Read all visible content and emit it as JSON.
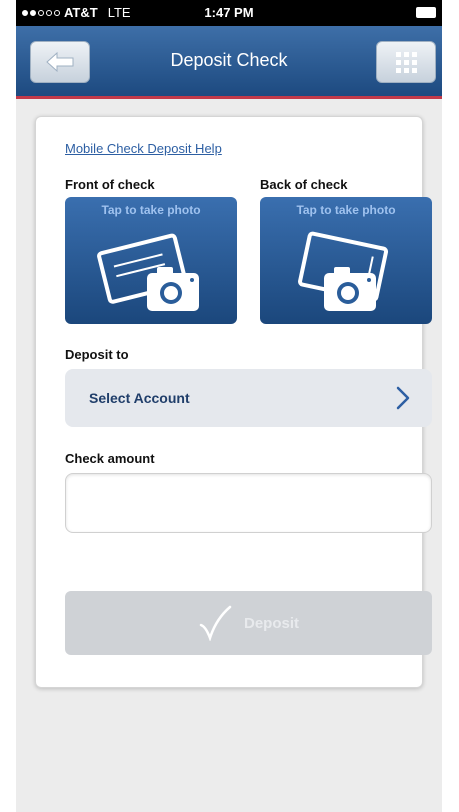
{
  "status_bar": {
    "carrier": "AT&T",
    "network": "LTE",
    "time": "1:47 PM"
  },
  "nav": {
    "title": "Deposit Check",
    "back_icon": "arrow-left-icon",
    "menu_icon": "grid-menu-icon"
  },
  "help_link": "Mobile Check Deposit Help",
  "front": {
    "label": "Front of check",
    "hint": "Tap to take photo",
    "icon": "camera-icon"
  },
  "back": {
    "label": "Back of check",
    "hint": "Tap to take photo",
    "icon": "camera-icon"
  },
  "deposit_to": {
    "label": "Deposit to",
    "select_label": "Select Account",
    "icon": "chevron-right-icon"
  },
  "check_amount": {
    "label": "Check amount",
    "value": ""
  },
  "deposit_button": {
    "label": "Deposit",
    "icon": "checkmark-icon"
  },
  "colors": {
    "nav_blue": "#2a5a94",
    "nav_accent": "#c23a4a",
    "tile_blue": "#2a5d9a",
    "link": "#2d5fa3",
    "disabled_button": "#cfd2d6"
  }
}
